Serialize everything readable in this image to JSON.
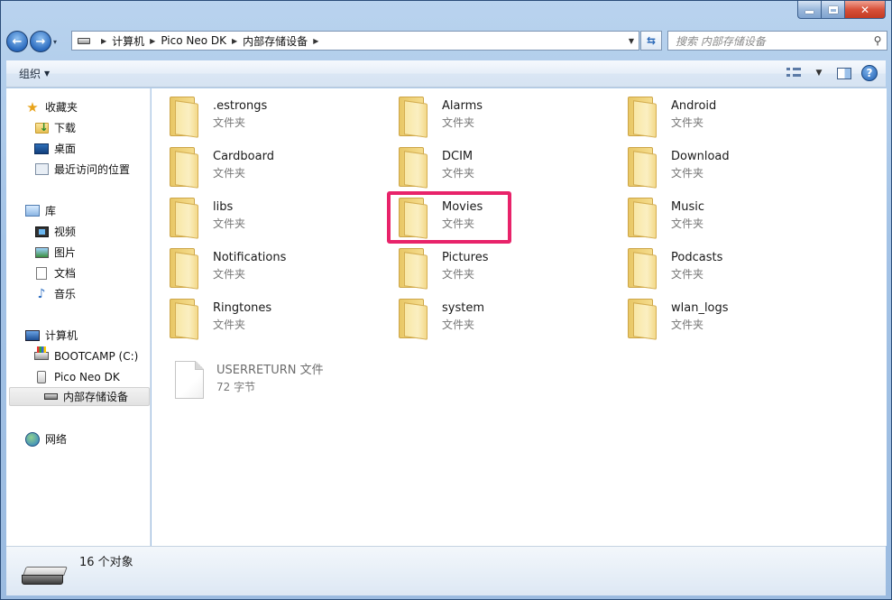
{
  "nav": {
    "back_glyph": "←",
    "forward_glyph": "→",
    "breadcrumbs": [
      "计算机",
      "Pico Neo DK",
      "内部存储设备"
    ],
    "search_placeholder": "搜索 内部存储设备"
  },
  "toolbar": {
    "organize_label": "组织"
  },
  "sidebar": {
    "favorites": {
      "label": "收藏夹",
      "items": [
        "下载",
        "桌面",
        "最近访问的位置"
      ]
    },
    "libraries": {
      "label": "库",
      "items": [
        "视频",
        "图片",
        "文档",
        "音乐"
      ]
    },
    "computer": {
      "label": "计算机",
      "items": [
        "BOOTCAMP (C:)",
        "Pico Neo DK",
        "内部存储设备"
      ]
    },
    "network": {
      "label": "网络"
    }
  },
  "folders": [
    {
      "name": ".estrongs",
      "type": "文件夹"
    },
    {
      "name": "Alarms",
      "type": "文件夹"
    },
    {
      "name": "Android",
      "type": "文件夹"
    },
    {
      "name": "Cardboard",
      "type": "文件夹"
    },
    {
      "name": "DCIM",
      "type": "文件夹"
    },
    {
      "name": "Download",
      "type": "文件夹"
    },
    {
      "name": "libs",
      "type": "文件夹"
    },
    {
      "name": "Movies",
      "type": "文件夹"
    },
    {
      "name": "Music",
      "type": "文件夹"
    },
    {
      "name": "Notifications",
      "type": "文件夹"
    },
    {
      "name": "Pictures",
      "type": "文件夹"
    },
    {
      "name": "Podcasts",
      "type": "文件夹"
    },
    {
      "name": "Ringtones",
      "type": "文件夹"
    },
    {
      "name": "system",
      "type": "文件夹"
    },
    {
      "name": "wlan_logs",
      "type": "文件夹"
    }
  ],
  "files": [
    {
      "name": "USERRETURN 文件",
      "size": "72 字节"
    }
  ],
  "status": {
    "count": "16 个对象"
  },
  "colors": {
    "highlight": "#e8236a"
  }
}
